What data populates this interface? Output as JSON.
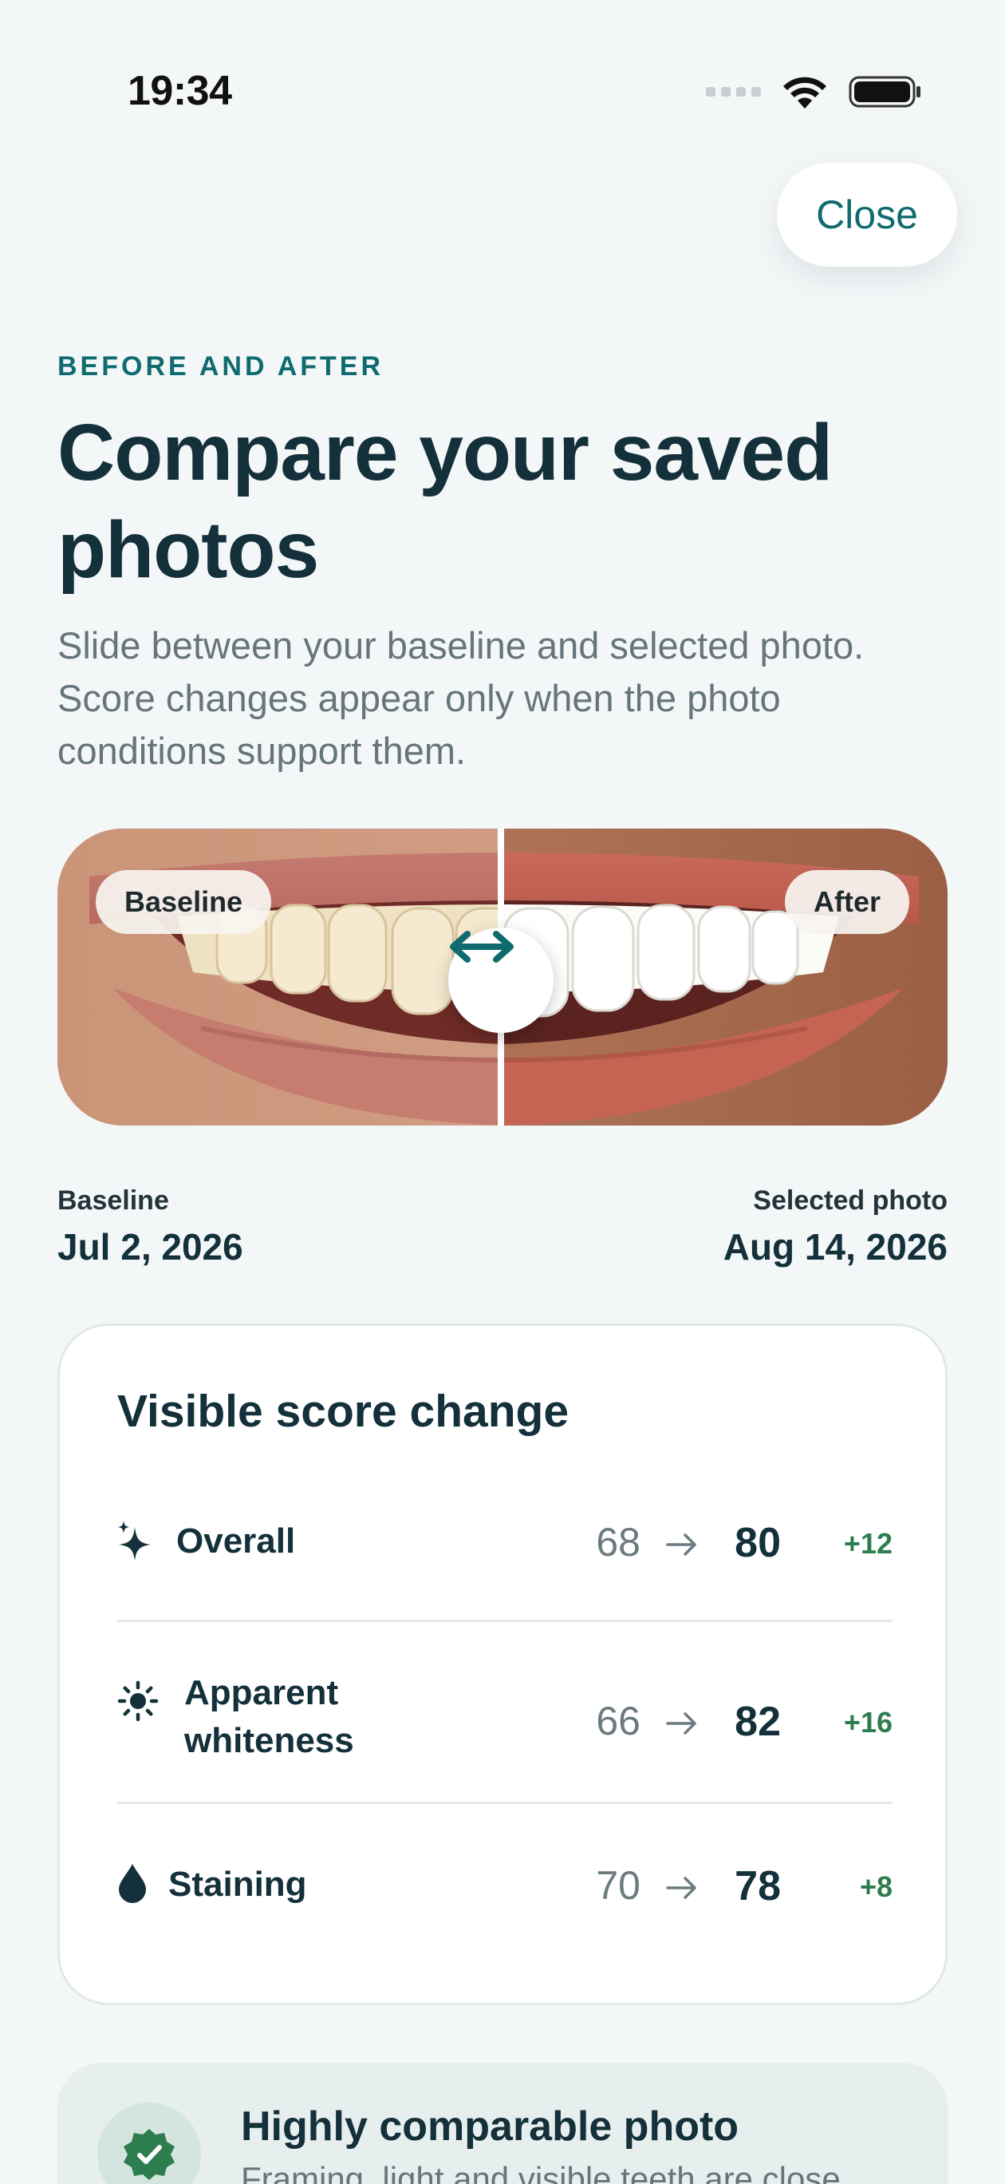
{
  "status_bar": {
    "time": "19:34"
  },
  "header": {
    "close_label": "Close"
  },
  "intro": {
    "eyebrow": "BEFORE AND AFTER",
    "title": "Compare your saved photos",
    "subtitle": "Slide between your baseline and selected photo. Score changes appear only when the photo conditions support them."
  },
  "comparison": {
    "left_tag": "Baseline",
    "right_tag": "After",
    "slider_position": 0.5
  },
  "dates": {
    "baseline_label": "Baseline",
    "baseline_date": "Jul 2, 2026",
    "selected_label": "Selected photo",
    "selected_date": "Aug 14, 2026"
  },
  "score_card": {
    "title": "Visible score change",
    "rows": [
      {
        "icon": "sparkle-icon",
        "label": "Overall",
        "before": "68",
        "after": "80",
        "delta": "+12"
      },
      {
        "icon": "sun-icon",
        "label_line1": "Apparent",
        "label_line2": "whiteness",
        "before": "66",
        "after": "82",
        "delta": "+16"
      },
      {
        "icon": "drop-icon",
        "label": "Staining",
        "before": "70",
        "after": "78",
        "delta": "+8"
      }
    ]
  },
  "comparable": {
    "title": "Highly comparable photo",
    "text": "Framing, light and visible teeth are close"
  },
  "colors": {
    "accent": "#0f6b6e",
    "positive": "#2e7d4e",
    "text": "#14303a",
    "muted": "#66757b"
  }
}
